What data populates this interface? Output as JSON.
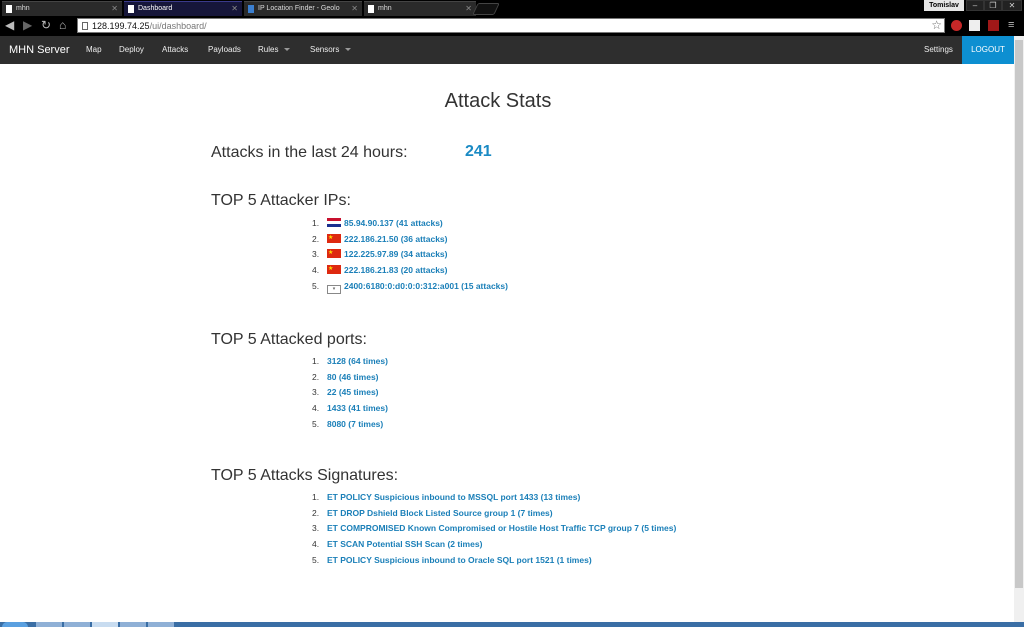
{
  "browser": {
    "tabs": [
      {
        "title": "mhn"
      },
      {
        "title": "Dashboard"
      },
      {
        "title": "IP Location Finder - Geolo"
      },
      {
        "title": "mhn"
      }
    ],
    "user": "Tomislav",
    "url_host": "128.199.74.25",
    "url_path": "/ui/dashboard/"
  },
  "navbar": {
    "brand": "MHN Server",
    "links": [
      "Map",
      "Deploy",
      "Attacks",
      "Payloads",
      "Rules",
      "Sensors"
    ],
    "settings": "Settings",
    "logout": "LOGOUT"
  },
  "page": {
    "title": "Attack Stats",
    "attacks_label": "Attacks in the last 24 hours:",
    "attacks_count": "241",
    "top_ips_title": "TOP 5 Attacker IPs:",
    "top_ips": [
      {
        "num": "1.",
        "text": "85.94.90.137 (41 attacks)",
        "flag": "hr"
      },
      {
        "num": "2.",
        "text": "222.186.21.50 (36 attacks)",
        "flag": "cn"
      },
      {
        "num": "3.",
        "text": "122.225.97.89 (34 attacks)",
        "flag": "cn"
      },
      {
        "num": "4.",
        "text": "222.186.21.83 (20 attacks)",
        "flag": "cn"
      },
      {
        "num": "5.",
        "text": "2400:6180:0:d0:0:0:312:a001 (15 attacks)",
        "flag": "unknown"
      }
    ],
    "top_ports_title": "TOP 5 Attacked ports:",
    "top_ports": [
      {
        "num": "1.",
        "text": "3128 (64 times)"
      },
      {
        "num": "2.",
        "text": "80 (46 times)"
      },
      {
        "num": "3.",
        "text": "22 (45 times)"
      },
      {
        "num": "4.",
        "text": "1433 (41 times)"
      },
      {
        "num": "5.",
        "text": "8080 (7 times)"
      }
    ],
    "top_sigs_title": "TOP 5 Attacks Signatures:",
    "top_sigs": [
      {
        "num": "1.",
        "text": "ET POLICY Suspicious inbound to MSSQL port 1433 (13 times)"
      },
      {
        "num": "2.",
        "text": "ET DROP Dshield Block Listed Source group 1 (7 times)"
      },
      {
        "num": "3.",
        "text": "ET COMPROMISED Known Compromised or Hostile Host Traffic TCP group 7 (5 times)"
      },
      {
        "num": "4.",
        "text": "ET SCAN Potential SSH Scan (2 times)"
      },
      {
        "num": "5.",
        "text": "ET POLICY Suspicious inbound to Oracle SQL port 1521 (1 times)"
      }
    ]
  },
  "colors": {
    "accent": "#0d8fd1",
    "link": "#1a7fb8",
    "navbar": "#2e2e2e"
  }
}
